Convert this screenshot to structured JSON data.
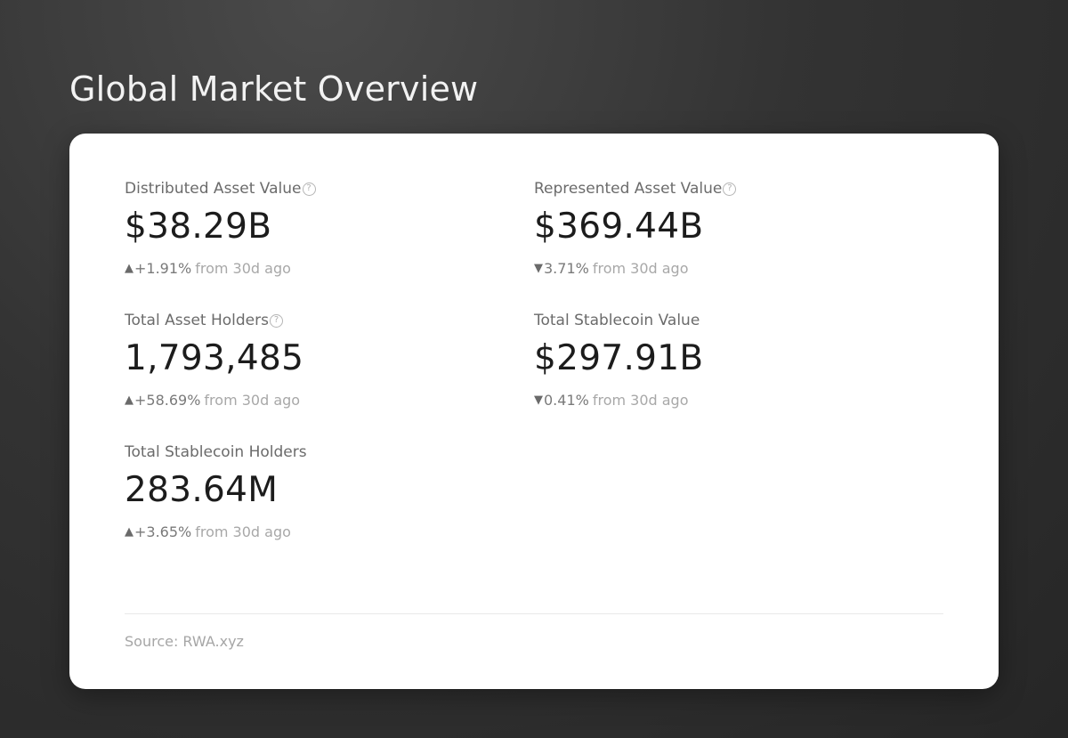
{
  "page": {
    "title": "Global Market Overview"
  },
  "metrics": [
    {
      "label": "Distributed Asset Value",
      "help_icon": "?",
      "value": "$38.29B",
      "arrow": "▲",
      "change": "+1.91%",
      "suffix": "from 30d ago"
    },
    {
      "label": "Represented Asset Value",
      "help_icon": "?",
      "value": "$369.44B",
      "arrow": "▼",
      "change": "3.71%",
      "suffix": "from 30d ago"
    },
    {
      "label": "Total Asset Holders",
      "help_icon": "?",
      "value": "1,793,485",
      "arrow": "▲",
      "change": "+58.69%",
      "suffix": "from 30d ago"
    },
    {
      "label": "Total Stablecoin Value",
      "value": "$297.91B",
      "arrow": "▼",
      "change": "0.41%",
      "suffix": "from 30d ago"
    },
    {
      "label": "Total Stablecoin Holders",
      "value": "283.64M",
      "arrow": "▲",
      "change": "+3.65%",
      "suffix": "from 30d ago"
    }
  ],
  "footer": {
    "source": "Source: RWA.xyz"
  },
  "colors": {
    "background": "#2e2e2e",
    "card": "#ffffff",
    "title": "#f2f2f2",
    "value": "#1c1c1c"
  }
}
